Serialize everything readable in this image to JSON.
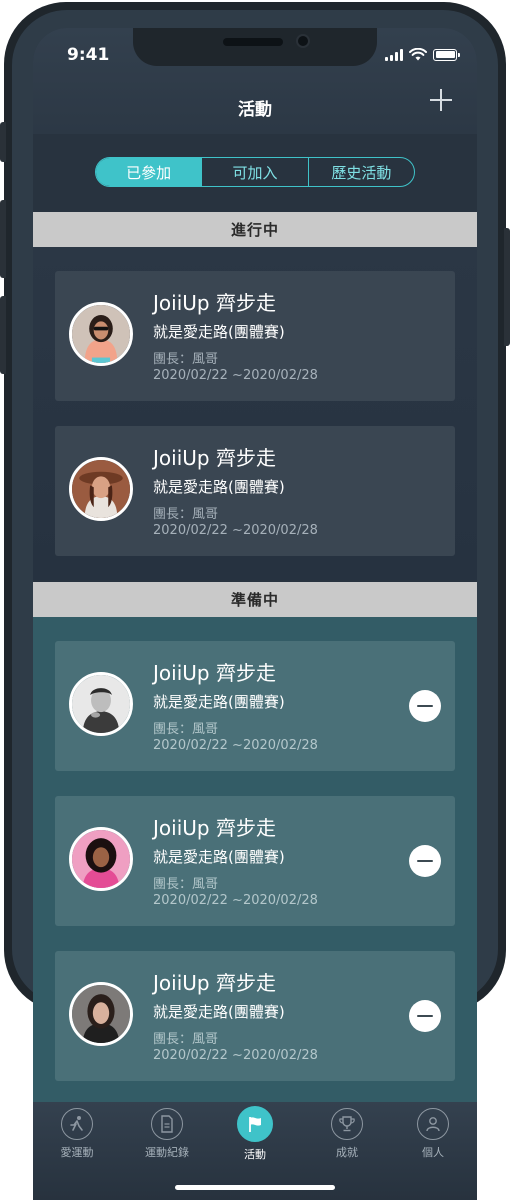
{
  "status_bar": {
    "time": "9:41"
  },
  "nav": {
    "title": "活動"
  },
  "tabs": [
    {
      "label": "已參加",
      "active": true
    },
    {
      "label": "可加入",
      "active": false
    },
    {
      "label": "歷史活動",
      "active": false
    }
  ],
  "sections": {
    "ongoing": "進行中",
    "preparing": "準備中"
  },
  "ongoing_cards": [
    {
      "title": "JoiiUp 齊步走",
      "subtitle": "就是愛走路(團體賽)",
      "leader": "團長：風哥",
      "dates": "2020/02/22 ~2020/02/28"
    },
    {
      "title": "JoiiUp 齊步走",
      "subtitle": "就是愛走路(團體賽)",
      "leader": "團長：風哥",
      "dates": "2020/02/22 ~2020/02/28"
    }
  ],
  "preparing_cards": [
    {
      "title": "JoiiUp 齊步走",
      "subtitle": "就是愛走路(團體賽)",
      "leader": "團長：風哥",
      "dates": "2020/02/22 ~2020/02/28"
    },
    {
      "title": "JoiiUp 齊步走",
      "subtitle": "就是愛走路(團體賽)",
      "leader": "團長：風哥",
      "dates": "2020/02/22 ~2020/02/28"
    },
    {
      "title": "JoiiUp 齊步走",
      "subtitle": "就是愛走路(團體賽)",
      "leader": "團長：風哥",
      "dates": "2020/02/22 ~2020/02/28"
    }
  ],
  "tabbar": [
    {
      "label": "愛運動",
      "icon": "running-icon"
    },
    {
      "label": "運動紀錄",
      "icon": "document-icon"
    },
    {
      "label": "活動",
      "icon": "flag-icon",
      "active": true
    },
    {
      "label": "成就",
      "icon": "trophy-icon"
    },
    {
      "label": "個人",
      "icon": "person-icon"
    }
  ],
  "colors": {
    "accent": "#3fc3c9",
    "screen_bg": "#28333f",
    "preparing_bg": "#335c66",
    "section_header": "#c9c9c9"
  }
}
